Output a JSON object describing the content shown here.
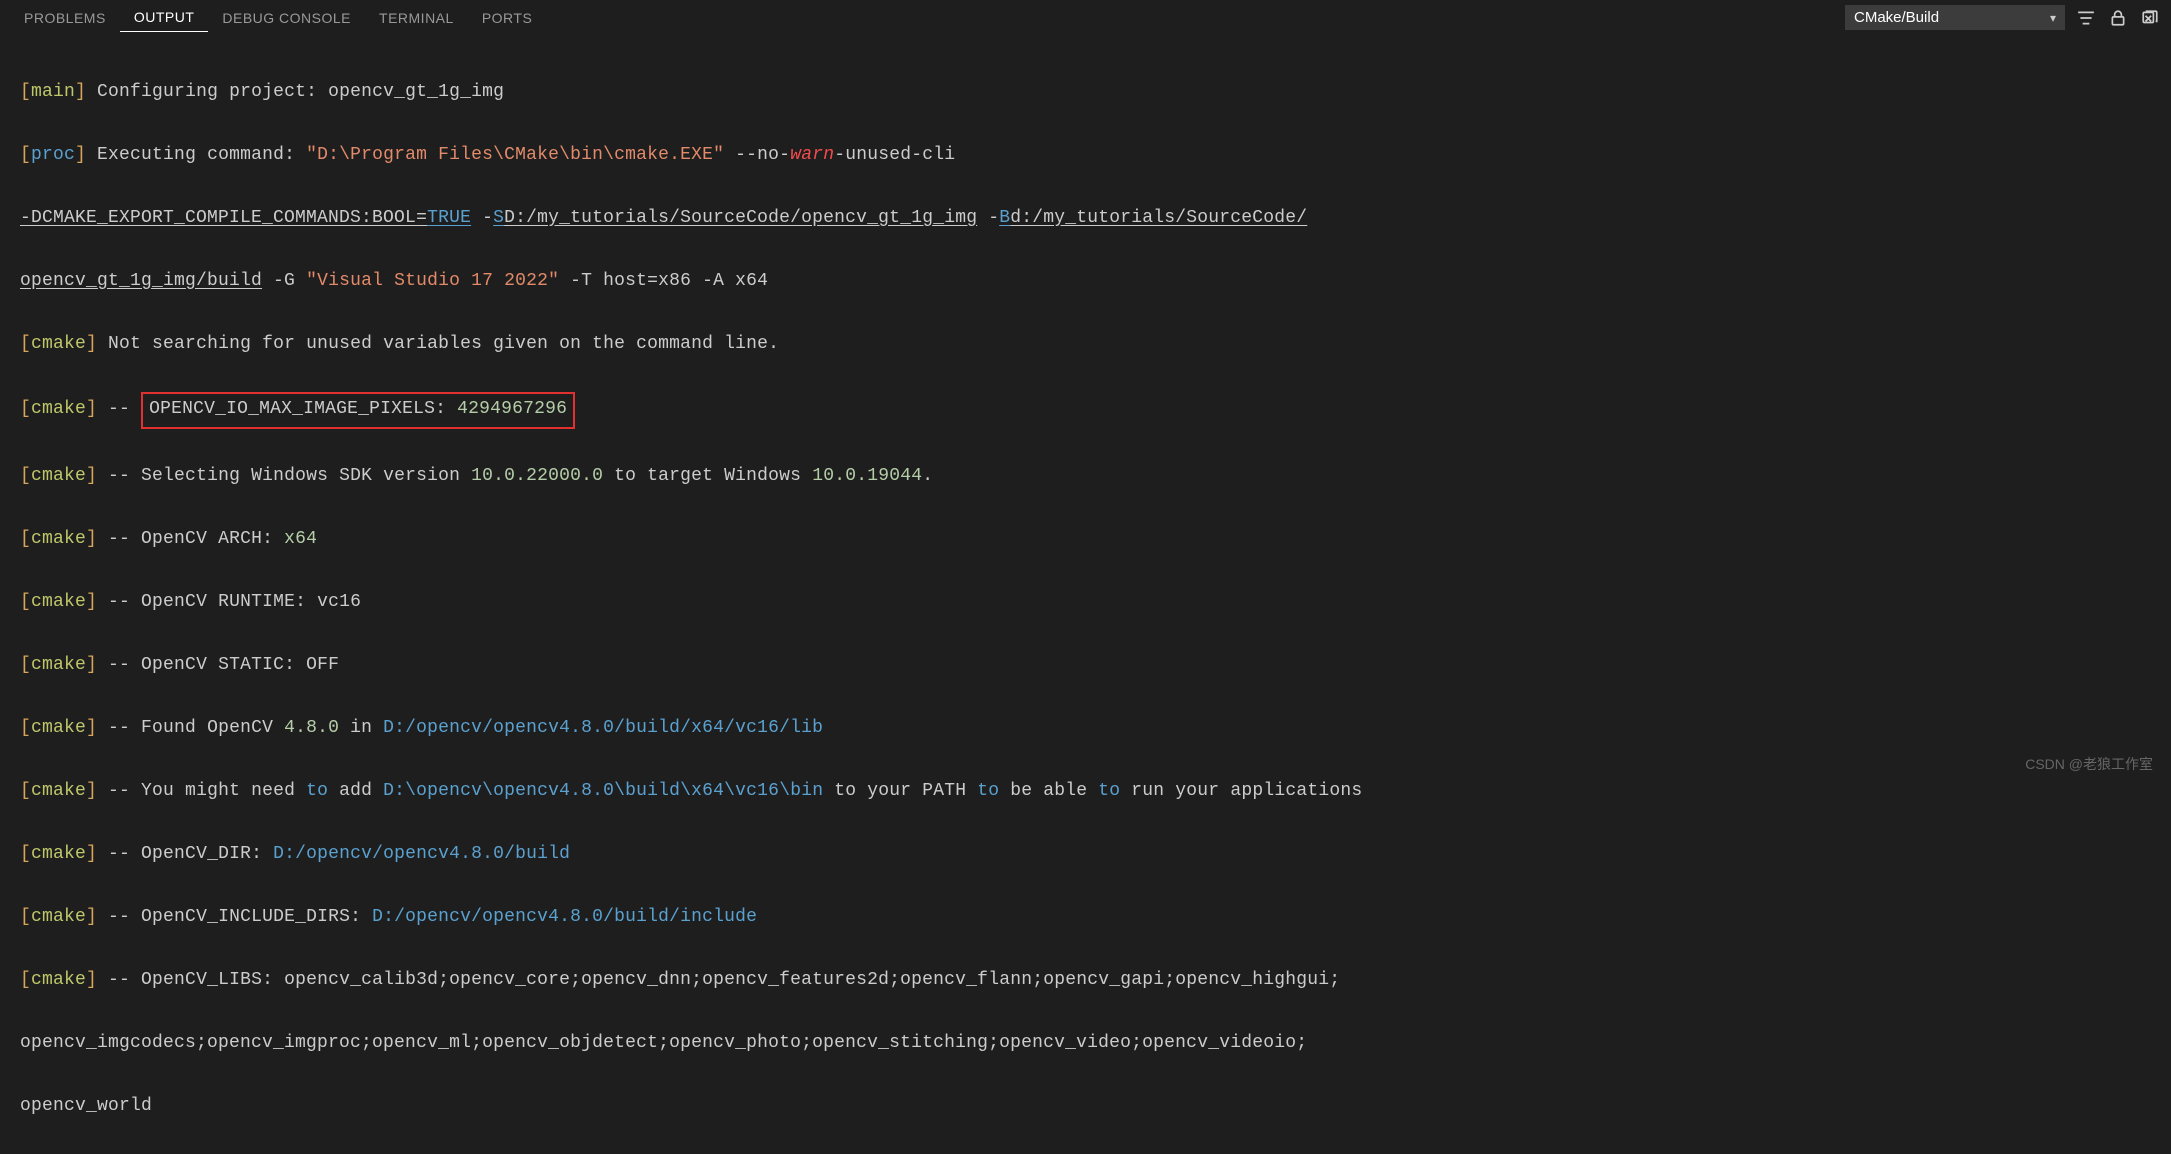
{
  "tabs": {
    "problems": "PROBLEMS",
    "output": "OUTPUT",
    "debug": "DEBUG CONSOLE",
    "terminal": "TERMINAL",
    "ports": "PORTS"
  },
  "dropdown": {
    "selected": "CMake/Build"
  },
  "brackets": {
    "open": "[",
    "close": "]"
  },
  "tags": {
    "main": "main",
    "proc": "proc",
    "cmake": "cmake"
  },
  "l1": {
    "text": " Configuring project: opencv_gt_1g_img"
  },
  "l2": {
    "a": " Executing command: ",
    "path": "\"D:\\Program Files\\CMake\\bin\\cmake.EXE\"",
    "b": " --no-",
    "warn": "warn",
    "c": "-unused-cli "
  },
  "l3": {
    "a": "-DCMAKE_EXPORT_COMPILE_COMMANDS:BOOL=",
    "true": "TRUE",
    "b": " -",
    "s": "S",
    "spath": "D:/my_tutorials/SourceCode/opencv_gt_1g_img",
    "c": " -",
    "bflag": "B",
    "bpath": "d:/my_tutorials/SourceCode/"
  },
  "l4": {
    "bpath2": "opencv_gt_1g_img/build",
    "a": " -G ",
    "gen": "\"Visual Studio 17 2022\"",
    "b": " -T host=x86 -A x64"
  },
  "l5": {
    "text": " Not searching for unused variables given on the command line."
  },
  "l6": {
    "a": " -- ",
    "label": "OPENCV_IO_MAX_IMAGE_PIXELS: ",
    "val": "4294967296"
  },
  "l7": {
    "a": " -- Selecting Windows SDK version ",
    "v1": "10.0.22000.0",
    "b": " to target Windows ",
    "v2": "10.0.19044",
    "c": "."
  },
  "l8": {
    "a": " -- OpenCV ARCH: ",
    "v": "x64"
  },
  "l9": {
    "a": " -- OpenCV RUNTIME: vc16"
  },
  "l10": {
    "a": " -- OpenCV STATIC: OFF"
  },
  "l11": {
    "a": " -- Found OpenCV ",
    "ver": "4.8.0",
    "b": " in ",
    "path": "D:/opencv/opencv4.8.0/build/x64/vc16/lib"
  },
  "l12": {
    "a": " -- You might need ",
    "to": "to",
    "b": " add ",
    "path": "D:\\opencv\\opencv4.8.0\\build\\x64\\vc16\\bin",
    "c": " to your PATH ",
    "to2": "to",
    "d": " be able ",
    "to3": "to",
    "e": " run your applications"
  },
  "l13": {
    "a": " -- OpenCV_DIR: ",
    "path": "D:/opencv/opencv4.8.0/build"
  },
  "l14": {
    "a": " -- OpenCV_INCLUDE_DIRS: ",
    "path": "D:/opencv/opencv4.8.0/build/include"
  },
  "l15": {
    "a": " -- OpenCV_LIBS: opencv_calib3d;opencv_core;opencv_dnn;opencv_features2d;opencv_flann;opencv_gapi;opencv_highgui;"
  },
  "l16": {
    "a": "opencv_imgcodecs;opencv_imgproc;opencv_ml;opencv_objdetect;opencv_photo;opencv_stitching;opencv_video;opencv_videoio;"
  },
  "l17": {
    "a": "opencv_world"
  },
  "watermark": "CSDN @老狼工作室"
}
